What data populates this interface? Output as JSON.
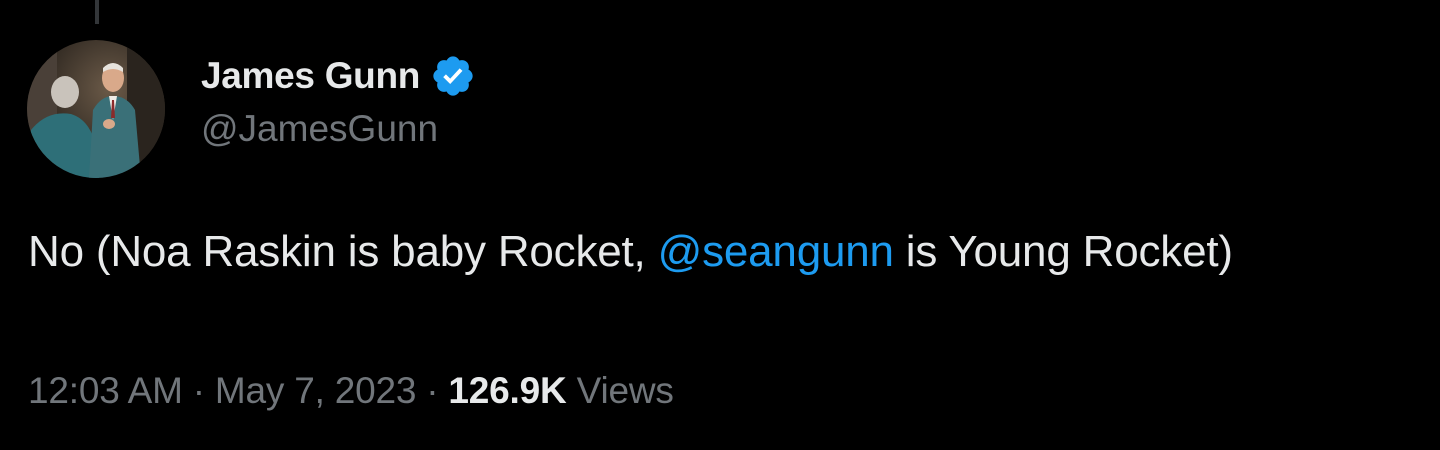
{
  "tweet": {
    "author": {
      "display_name": "James Gunn",
      "handle": "@JamesGunn",
      "verified": true,
      "avatar_icon": "profile-photo"
    },
    "body": {
      "prefix": "No (Noa Raskin is baby Rocket, ",
      "mention": "@seangunn",
      "suffix": " is Young Rocket)"
    },
    "meta": {
      "time": "12:03 AM",
      "separator": "·",
      "date": "May 7, 2023",
      "views_count": "126.9K",
      "views_label": "Views"
    }
  },
  "colors": {
    "background": "#000000",
    "primary_text": "#e7e9ea",
    "secondary_text": "#71767b",
    "accent": "#1d9bf0"
  }
}
